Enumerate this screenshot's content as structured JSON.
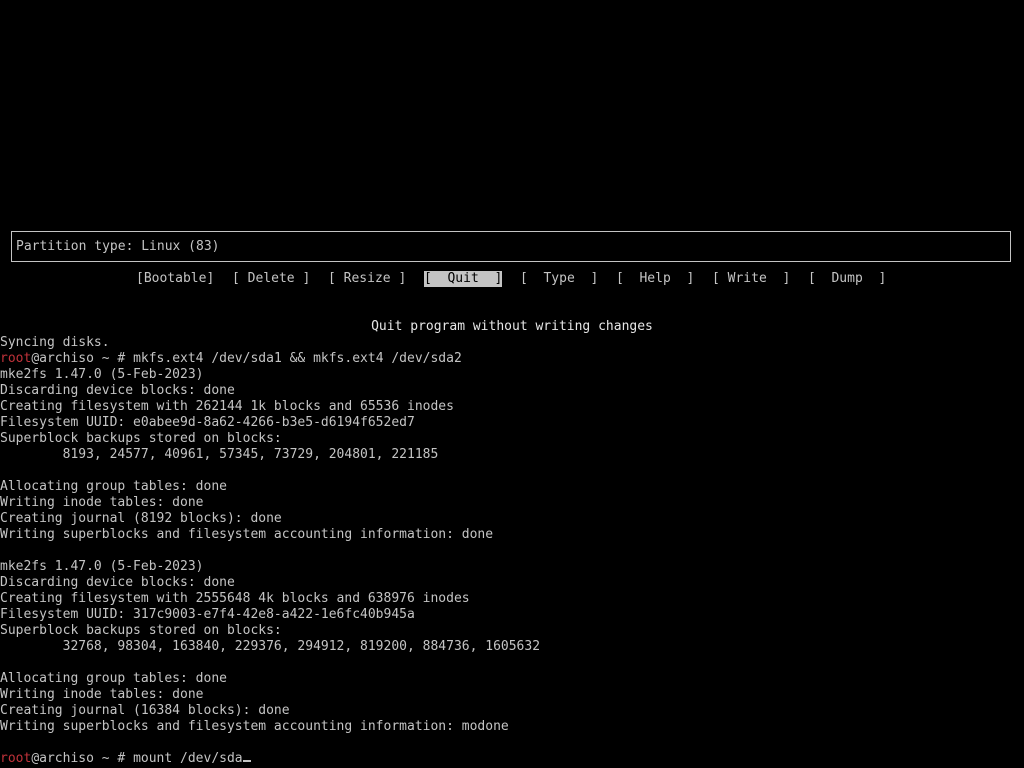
{
  "info_box": {
    "text": "Partition type: Linux (83)"
  },
  "menu": [
    {
      "label": "[Bootable]",
      "selected": false
    },
    {
      "label": "[ Delete ]",
      "selected": false
    },
    {
      "label": "[ Resize ]",
      "selected": false
    },
    {
      "label": "[  Quit  ]",
      "selected": true
    },
    {
      "label": "[  Type  ]",
      "selected": false
    },
    {
      "label": "[  Help  ]",
      "selected": false
    },
    {
      "label": "[ Write  ]",
      "selected": false
    },
    {
      "label": "[  Dump  ]",
      "selected": false
    }
  ],
  "hint": "Quit program without writing changes",
  "terminal": {
    "prompt_user": "root",
    "prompt_rest": "@archiso ~ # ",
    "lines": [
      "Syncing disks.",
      {
        "prompt": true,
        "cmd": "mkfs.ext4 /dev/sda1 && mkfs.ext4 /dev/sda2"
      },
      "mke2fs 1.47.0 (5-Feb-2023)",
      "Discarding device blocks: done",
      "Creating filesystem with 262144 1k blocks and 65536 inodes",
      "Filesystem UUID: e0abee9d-8a62-4266-b3e5-d6194f652ed7",
      "Superblock backups stored on blocks:",
      "        8193, 24577, 40961, 57345, 73729, 204801, 221185",
      "",
      "Allocating group tables: done",
      "Writing inode tables: done",
      "Creating journal (8192 blocks): done",
      "Writing superblocks and filesystem accounting information: done",
      "",
      "mke2fs 1.47.0 (5-Feb-2023)",
      "Discarding device blocks: done",
      "Creating filesystem with 2555648 4k blocks and 638976 inodes",
      "Filesystem UUID: 317c9003-e7f4-42e8-a422-1e6fc40b945a",
      "Superblock backups stored on blocks:",
      "        32768, 98304, 163840, 229376, 294912, 819200, 884736, 1605632",
      "",
      "Allocating group tables: done",
      "Writing inode tables: done",
      "Creating journal (16384 blocks): done",
      "Writing superblocks and filesystem accounting information: modone",
      "",
      {
        "prompt": true,
        "cmd": "mount /dev/sda",
        "cursor": true
      }
    ]
  }
}
